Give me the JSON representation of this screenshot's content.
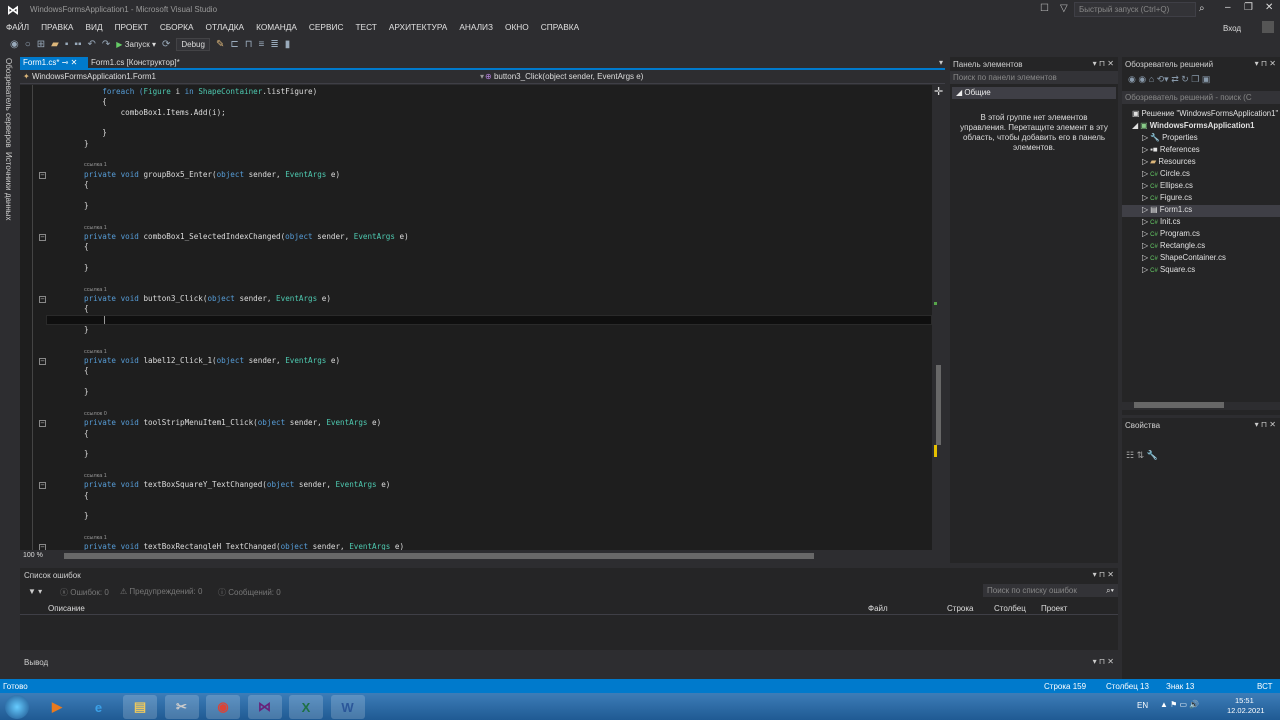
{
  "window": {
    "title": "WindowsFormsApplication1 - Microsoft Visual Studio",
    "quick_launch_placeholder": "Быстрый запуск (Ctrl+Q)",
    "signin": "Вход"
  },
  "menu": [
    "ФАЙЛ",
    "ПРАВКА",
    "ВИД",
    "ПРОЕКТ",
    "СБОРКА",
    "ОТЛАДКА",
    "КОМАНДА",
    "СЕРВИС",
    "ТЕСТ",
    "АРХИТЕКТУРА",
    "АНАЛИЗ",
    "ОКНО",
    "СПРАВКА"
  ],
  "toolbar": {
    "start": "Запуск",
    "config": "Debug"
  },
  "side_tabs": [
    "Обозреватель серверов",
    "Источники данных"
  ],
  "tabs": [
    {
      "label": "Form1.cs*",
      "active": true
    },
    {
      "label": "Form1.cs [Конструктор]*",
      "active": false
    }
  ],
  "nav": {
    "class": "WindowsFormsApplication1.Form1",
    "member": "button3_Click(object sender, EventArgs e)"
  },
  "code": [
    [
      [
        "    foreach (",
        "kw"
      ],
      [
        "Figure",
        "ty"
      ],
      [
        " i ",
        ""
      ],
      [
        "in ",
        "kw"
      ],
      [
        "ShapeContainer",
        "ty"
      ],
      [
        ".listFigure)",
        ""
      ]
    ],
    [
      [
        "    {",
        ""
      ]
    ],
    [
      [
        "        comboBox1.Items.Add(i);",
        ""
      ]
    ],
    [
      [
        "",
        ""
      ]
    ],
    [
      [
        "    }",
        ""
      ]
    ],
    [
      [
        "}",
        ""
      ]
    ],
    [
      [
        "",
        ""
      ]
    ],
    [
      [
        "ссылка 1",
        "lens"
      ]
    ],
    [
      [
        "private void ",
        "kw"
      ],
      [
        "groupBox5_Enter(",
        ""
      ],
      [
        "object",
        "kw"
      ],
      [
        " sender, ",
        ""
      ],
      [
        "EventArgs",
        "ty"
      ],
      [
        " e)",
        ""
      ]
    ],
    [
      [
        "{",
        ""
      ]
    ],
    [
      [
        "",
        ""
      ]
    ],
    [
      [
        "}",
        ""
      ]
    ],
    [
      [
        "",
        ""
      ]
    ],
    [
      [
        "ссылка 1",
        "lens"
      ]
    ],
    [
      [
        "private void ",
        "kw"
      ],
      [
        "comboBox1_SelectedIndexChanged(",
        ""
      ],
      [
        "object",
        "kw"
      ],
      [
        " sender, ",
        ""
      ],
      [
        "EventArgs",
        "ty"
      ],
      [
        " e)",
        ""
      ]
    ],
    [
      [
        "{",
        ""
      ]
    ],
    [
      [
        "",
        ""
      ]
    ],
    [
      [
        "}",
        ""
      ]
    ],
    [
      [
        "",
        ""
      ]
    ],
    [
      [
        "ссылка 1",
        "lens"
      ]
    ],
    [
      [
        "private void ",
        "kw"
      ],
      [
        "button3_Click(",
        ""
      ],
      [
        "object",
        "kw"
      ],
      [
        " sender, ",
        ""
      ],
      [
        "EventArgs",
        "ty"
      ],
      [
        " e)",
        ""
      ]
    ],
    [
      [
        "{",
        ""
      ]
    ],
    [
      [
        "    |",
        ""
      ]
    ],
    [
      [
        "}",
        ""
      ]
    ],
    [
      [
        "",
        ""
      ]
    ],
    [
      [
        "ссылка 1",
        "lens"
      ]
    ],
    [
      [
        "private void ",
        "kw"
      ],
      [
        "label12_Click_1(",
        ""
      ],
      [
        "object",
        "kw"
      ],
      [
        " sender, ",
        ""
      ],
      [
        "EventArgs",
        "ty"
      ],
      [
        " e)",
        ""
      ]
    ],
    [
      [
        "{",
        ""
      ]
    ],
    [
      [
        "",
        ""
      ]
    ],
    [
      [
        "}",
        ""
      ]
    ],
    [
      [
        "",
        ""
      ]
    ],
    [
      [
        "ссылок 0",
        "lens"
      ]
    ],
    [
      [
        "private void ",
        "kw"
      ],
      [
        "toolStripMenuItem1_Click(",
        ""
      ],
      [
        "object",
        "kw"
      ],
      [
        " sender, ",
        ""
      ],
      [
        "EventArgs",
        "ty"
      ],
      [
        " e)",
        ""
      ]
    ],
    [
      [
        "{",
        ""
      ]
    ],
    [
      [
        "",
        ""
      ]
    ],
    [
      [
        "}",
        ""
      ]
    ],
    [
      [
        "",
        ""
      ]
    ],
    [
      [
        "ссылка 1",
        "lens"
      ]
    ],
    [
      [
        "private void ",
        "kw"
      ],
      [
        "textBoxSquareY_TextChanged(",
        ""
      ],
      [
        "object",
        "kw"
      ],
      [
        " sender, ",
        ""
      ],
      [
        "EventArgs",
        "ty"
      ],
      [
        " e)",
        ""
      ]
    ],
    [
      [
        "{",
        ""
      ]
    ],
    [
      [
        "",
        ""
      ]
    ],
    [
      [
        "}",
        ""
      ]
    ],
    [
      [
        "",
        ""
      ]
    ],
    [
      [
        "ссылка 1",
        "lens"
      ]
    ],
    [
      [
        "private void ",
        "kw"
      ],
      [
        "textBoxRectangleH_TextChanged(",
        ""
      ],
      [
        "object",
        "kw"
      ],
      [
        " sender, ",
        ""
      ],
      [
        "EventArgs",
        "ty"
      ],
      [
        " e)",
        ""
      ]
    ]
  ],
  "zoom": "100 %",
  "toolbox": {
    "title": "Панель элементов",
    "search_placeholder": "Поиск по панели элементов",
    "group": "Общие",
    "empty_text": "В этой группе нет элементов управления. Перетащите элемент в эту область, чтобы добавить его в панель элементов."
  },
  "solution": {
    "title": "Обозреватель решений",
    "search_placeholder": "Обозреватель решений - поиск (C",
    "solution_label": "Решение \"WindowsFormsApplication1\"",
    "project": "WindowsFormsApplication1",
    "items": [
      "Properties",
      "References",
      "Resources",
      "Circle.cs",
      "Ellipse.cs",
      "Figure.cs",
      "Form1.cs",
      "Init.cs",
      "Program.cs",
      "Rectangle.cs",
      "ShapeContainer.cs",
      "Square.cs"
    ],
    "selected": "Form1.cs"
  },
  "properties": {
    "title": "Свойства"
  },
  "errors": {
    "title": "Список ошибок",
    "errors": "Ошибок: 0",
    "warnings": "Предупреждений: 0",
    "messages": "Сообщений: 0",
    "search_placeholder": "Поиск по списку ошибок",
    "columns": [
      "Описание",
      "Файл",
      "Строка",
      "Столбец",
      "Проект"
    ]
  },
  "output": {
    "title": "Вывод"
  },
  "status": {
    "ready": "Готово",
    "line": "Строка 159",
    "col": "Столбец 13",
    "char": "Знак 13",
    "mode": "ВСТ"
  },
  "taskbar": {
    "lang": "EN",
    "time": "15:51",
    "date": "12.02.2021",
    "apps": [
      "media-player",
      "internet-explorer",
      "explorer",
      "snipping-tool",
      "chrome",
      "visual-studio",
      "excel",
      "word"
    ]
  },
  "colors": {
    "accent": "#007acc",
    "background": "#1e1e1e",
    "keyword": "#569cd6",
    "type": "#4ec9b0"
  }
}
